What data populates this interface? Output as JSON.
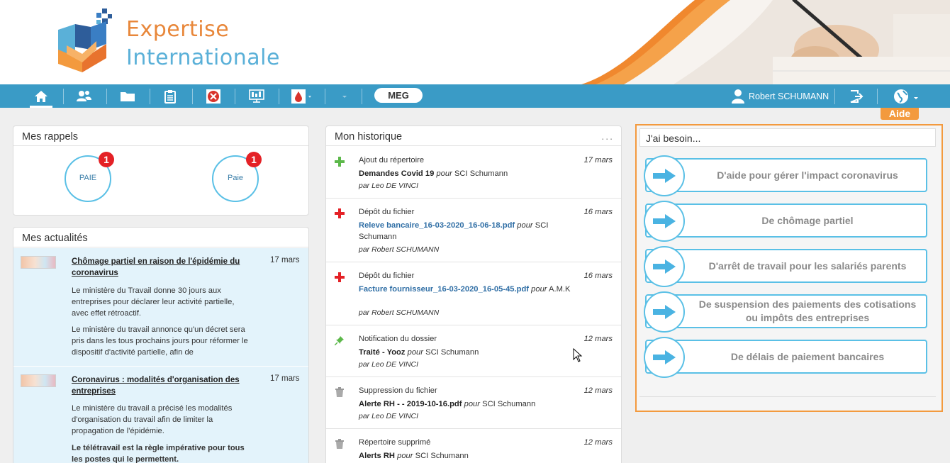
{
  "brand": {
    "line1": "Expertise",
    "line2": "Internationale"
  },
  "navbar": {
    "items": [
      {
        "name": "home-icon"
      },
      {
        "name": "users-icon"
      },
      {
        "name": "folder-icon"
      },
      {
        "name": "clipboard-icon"
      },
      {
        "name": "app-icon-red"
      },
      {
        "name": "monitor-icon"
      },
      {
        "name": "drop-icon"
      }
    ],
    "meg_label": "MEG",
    "user_name": "Robert SCHUMANN",
    "aide_label": "Aide"
  },
  "rappels": {
    "title": "Mes rappels",
    "items": [
      {
        "label": "PAIE",
        "count": "1"
      },
      {
        "label": "Paie",
        "count": "1"
      }
    ]
  },
  "actualites": {
    "title": "Mes actualités",
    "items": [
      {
        "title": "Chômage partiel en raison de l'épidémie du coronavirus",
        "date": "17 mars",
        "p1": "Le ministère du Travail donne 30 jours aux entreprises pour déclarer leur activité partielle, avec effet rétroactif.",
        "p2": "Le ministère du travail annonce qu'un décret sera pris dans les tous prochains jours pour réformer le dispositif d'activité partielle, afin de"
      },
      {
        "title": "Coronavirus : modalités d'organisation des entreprises",
        "date": "17 mars",
        "p1": "Le ministère du travail a précisé les modalités d'organisation du travail afin de limiter la propagation de l'épidémie.",
        "p2": "Le télétravail est la règle impérative pour tous les postes qui le permettent."
      }
    ]
  },
  "historique": {
    "title": "Mon historique",
    "menu": "...",
    "items": [
      {
        "action": "Ajout du répertoire",
        "date": "17 mars",
        "subject": "Demandes Covid 19",
        "link": "",
        "pour": "pour",
        "target": "SCI Schumann",
        "by": "par Leo DE VINCI",
        "icon": "plus-green"
      },
      {
        "action": "Dépôt du fichier",
        "date": "16 mars",
        "subject": "",
        "link": "Releve bancaire_16-03-2020_16-06-18.pdf",
        "pour": "pour",
        "target": "SCI Schumann",
        "by": "par Robert SCHUMANN",
        "icon": "plus-red"
      },
      {
        "action": "Dépôt du fichier",
        "date": "16 mars",
        "subject": "",
        "link": "Facture fournisseur_16-03-2020_16-05-45.pdf",
        "pour": "pour",
        "target": "A.M.K",
        "by": "par Robert SCHUMANN",
        "icon": "plus-red"
      },
      {
        "action": "Notification du dossier",
        "date": "12 mars",
        "subject": "Traité - Yooz",
        "link": "",
        "pour": "pour",
        "target": "SCI Schumann",
        "by": "par Leo DE VINCI",
        "icon": "pin"
      },
      {
        "action": "Suppression du fichier",
        "date": "12 mars",
        "subject": "Alerte RH - - 2019-10-16.pdf",
        "link": "",
        "pour": "pour",
        "target": "SCI Schumann",
        "by": "par Leo DE VINCI",
        "icon": "trash"
      },
      {
        "action": "Répertoire supprimé",
        "date": "12 mars",
        "subject": "Alerts RH",
        "link": "",
        "pour": "pour",
        "target": "SCI Schumann",
        "by": "",
        "icon": "trash"
      }
    ]
  },
  "aide": {
    "title": "J'ai besoin...",
    "buttons": [
      "D'aide pour gérer l'impact coronavirus",
      "De chômage partiel",
      "D'arrêt de travail pour les salariés parents",
      "De suspension des paiements des cotisations ou impôts des entreprises",
      "De délais de paiement bancaires"
    ]
  },
  "colors": {
    "navbar": "#3a9bc6",
    "accent_orange": "#f39a3e",
    "accent_blue": "#5ac0e6",
    "badge_red": "#e42126"
  }
}
